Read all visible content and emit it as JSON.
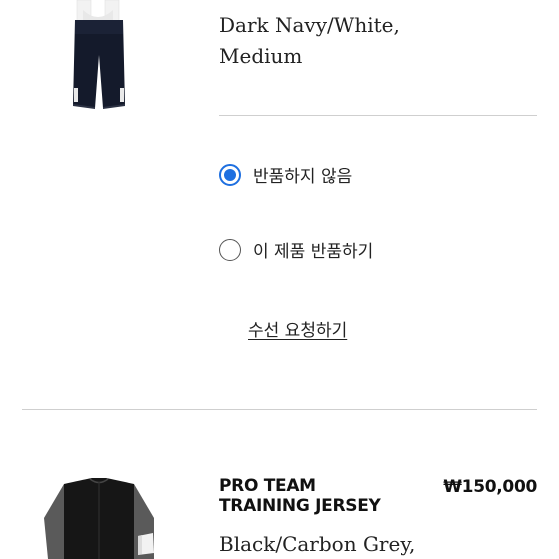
{
  "item1": {
    "image_label": "bib-shorts-image",
    "variant_lines": [
      "Dark Navy/White,",
      "Medium"
    ]
  },
  "return_options": {
    "selected_index": 0,
    "options": [
      {
        "label": "반품하지 않음",
        "checked": true
      },
      {
        "label": "이 제품 반품하기",
        "checked": false
      }
    ],
    "repair_link": "수선 요청하기"
  },
  "item2": {
    "name": "PRO TEAM TRAINING JERSEY",
    "price": "₩150,000",
    "variant": "Black/Carbon Grey,"
  },
  "colors": {
    "accent_blue": "#1e6fe0",
    "divider": "#cfcfcf"
  }
}
